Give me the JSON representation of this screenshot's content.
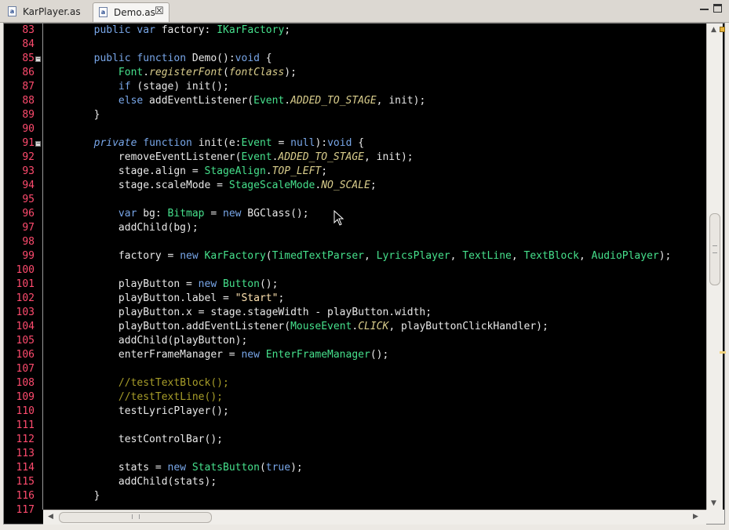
{
  "tabs": [
    {
      "label": "KarPlayer.as",
      "icon": "actionscript-file-icon",
      "active": false
    },
    {
      "label": "Demo.as",
      "icon": "actionscript-file-icon",
      "active": true
    }
  ],
  "close_glyph": "☒",
  "editor": {
    "lines": [
      {
        "n": "83",
        "fold": false,
        "tokens": [
          [
            "def",
            "        "
          ],
          [
            "kw",
            "public"
          ],
          [
            "def",
            " "
          ],
          [
            "kw",
            "var"
          ],
          [
            "def",
            " factory: "
          ],
          [
            "type",
            "IKarFactory"
          ],
          [
            "def",
            ";"
          ]
        ]
      },
      {
        "n": "84",
        "fold": false,
        "tokens": []
      },
      {
        "n": "85",
        "fold": true,
        "tokens": [
          [
            "def",
            "        "
          ],
          [
            "kw",
            "public"
          ],
          [
            "def",
            " "
          ],
          [
            "kw",
            "function"
          ],
          [
            "def",
            " Demo():"
          ],
          [
            "kw",
            "void"
          ],
          [
            "def",
            " {"
          ]
        ]
      },
      {
        "n": "86",
        "fold": false,
        "tokens": [
          [
            "def",
            "            "
          ],
          [
            "type",
            "Font"
          ],
          [
            "def",
            "."
          ],
          [
            "ital",
            "registerFont"
          ],
          [
            "def",
            "("
          ],
          [
            "ital",
            "fontClass"
          ],
          [
            "def",
            ");"
          ]
        ]
      },
      {
        "n": "87",
        "fold": false,
        "tokens": [
          [
            "def",
            "            "
          ],
          [
            "kw",
            "if"
          ],
          [
            "def",
            " (stage) init();"
          ]
        ]
      },
      {
        "n": "88",
        "fold": false,
        "tokens": [
          [
            "def",
            "            "
          ],
          [
            "kw",
            "else"
          ],
          [
            "def",
            " addEventListener("
          ],
          [
            "type",
            "Event"
          ],
          [
            "def",
            "."
          ],
          [
            "ital",
            "ADDED_TO_STAGE"
          ],
          [
            "def",
            ", init);"
          ]
        ]
      },
      {
        "n": "89",
        "fold": false,
        "tokens": [
          [
            "def",
            "        }"
          ]
        ]
      },
      {
        "n": "90",
        "fold": false,
        "tokens": []
      },
      {
        "n": "91",
        "fold": true,
        "tokens": [
          [
            "def",
            "        "
          ],
          [
            "kwi",
            "private"
          ],
          [
            "def",
            " "
          ],
          [
            "kw",
            "function"
          ],
          [
            "def",
            " init(e:"
          ],
          [
            "type",
            "Event"
          ],
          [
            "def",
            " = "
          ],
          [
            "kw",
            "null"
          ],
          [
            "def",
            "):"
          ],
          [
            "kw",
            "void"
          ],
          [
            "def",
            " {"
          ]
        ]
      },
      {
        "n": "92",
        "fold": false,
        "tokens": [
          [
            "def",
            "            removeEventListener("
          ],
          [
            "type",
            "Event"
          ],
          [
            "def",
            "."
          ],
          [
            "ital",
            "ADDED_TO_STAGE"
          ],
          [
            "def",
            ", init);"
          ]
        ]
      },
      {
        "n": "93",
        "fold": false,
        "tokens": [
          [
            "def",
            "            stage.align = "
          ],
          [
            "type",
            "StageAlign"
          ],
          [
            "def",
            "."
          ],
          [
            "ital",
            "TOP_LEFT"
          ],
          [
            "def",
            ";"
          ]
        ]
      },
      {
        "n": "94",
        "fold": false,
        "tokens": [
          [
            "def",
            "            stage.scaleMode = "
          ],
          [
            "type",
            "StageScaleMode"
          ],
          [
            "def",
            "."
          ],
          [
            "ital",
            "NO_SCALE"
          ],
          [
            "def",
            ";"
          ]
        ]
      },
      {
        "n": "95",
        "fold": false,
        "tokens": []
      },
      {
        "n": "96",
        "fold": false,
        "tokens": [
          [
            "def",
            "            "
          ],
          [
            "kw",
            "var"
          ],
          [
            "def",
            " bg: "
          ],
          [
            "type",
            "Bitmap"
          ],
          [
            "def",
            " = "
          ],
          [
            "kw",
            "new"
          ],
          [
            "def",
            " BGClass();"
          ]
        ]
      },
      {
        "n": "97",
        "fold": false,
        "tokens": [
          [
            "def",
            "            addChild(bg);"
          ]
        ]
      },
      {
        "n": "98",
        "fold": false,
        "tokens": []
      },
      {
        "n": "99",
        "fold": false,
        "tokens": [
          [
            "def",
            "            factory = "
          ],
          [
            "kw",
            "new"
          ],
          [
            "def",
            " "
          ],
          [
            "type",
            "KarFactory"
          ],
          [
            "def",
            "("
          ],
          [
            "type",
            "TimedTextParser"
          ],
          [
            "def",
            ", "
          ],
          [
            "type",
            "LyricsPlayer"
          ],
          [
            "def",
            ", "
          ],
          [
            "type",
            "TextLine"
          ],
          [
            "def",
            ", "
          ],
          [
            "type",
            "TextBlock"
          ],
          [
            "def",
            ", "
          ],
          [
            "type",
            "AudioPlayer"
          ],
          [
            "def",
            ");"
          ]
        ]
      },
      {
        "n": "100",
        "fold": false,
        "tokens": []
      },
      {
        "n": "101",
        "fold": false,
        "tokens": [
          [
            "def",
            "            playButton = "
          ],
          [
            "kw",
            "new"
          ],
          [
            "def",
            " "
          ],
          [
            "type",
            "Button"
          ],
          [
            "def",
            "();"
          ]
        ]
      },
      {
        "n": "102",
        "fold": false,
        "tokens": [
          [
            "def",
            "            playButton.label = "
          ],
          [
            "str",
            "\"Start\""
          ],
          [
            "def",
            ";"
          ]
        ]
      },
      {
        "n": "103",
        "fold": false,
        "tokens": [
          [
            "def",
            "            playButton.x = stage.stageWidth - playButton.width;"
          ]
        ]
      },
      {
        "n": "104",
        "fold": false,
        "tokens": [
          [
            "def",
            "            playButton.addEventListener("
          ],
          [
            "type",
            "MouseEvent"
          ],
          [
            "def",
            "."
          ],
          [
            "ital",
            "CLICK"
          ],
          [
            "def",
            ", playButtonClickHandler);"
          ]
        ]
      },
      {
        "n": "105",
        "fold": false,
        "tokens": [
          [
            "def",
            "            addChild(playButton);"
          ]
        ]
      },
      {
        "n": "106",
        "fold": false,
        "tokens": [
          [
            "def",
            "            enterFrameManager = "
          ],
          [
            "kw",
            "new"
          ],
          [
            "def",
            " "
          ],
          [
            "type",
            "EnterFrameManager"
          ],
          [
            "def",
            "();"
          ]
        ]
      },
      {
        "n": "107",
        "fold": false,
        "tokens": []
      },
      {
        "n": "108",
        "fold": false,
        "tokens": [
          [
            "def",
            "            "
          ],
          [
            "cmt",
            "//testTextBlock();"
          ]
        ]
      },
      {
        "n": "109",
        "fold": false,
        "tokens": [
          [
            "def",
            "            "
          ],
          [
            "cmt",
            "//testTextLine();"
          ]
        ]
      },
      {
        "n": "110",
        "fold": false,
        "tokens": [
          [
            "def",
            "            testLyricPlayer();"
          ]
        ]
      },
      {
        "n": "111",
        "fold": false,
        "tokens": []
      },
      {
        "n": "112",
        "fold": false,
        "tokens": [
          [
            "def",
            "            testControlBar();"
          ]
        ]
      },
      {
        "n": "113",
        "fold": false,
        "tokens": []
      },
      {
        "n": "114",
        "fold": false,
        "tokens": [
          [
            "def",
            "            stats = "
          ],
          [
            "kw",
            "new"
          ],
          [
            "def",
            " "
          ],
          [
            "type",
            "StatsButton"
          ],
          [
            "def",
            "("
          ],
          [
            "kw",
            "true"
          ],
          [
            "def",
            ");"
          ]
        ]
      },
      {
        "n": "115",
        "fold": false,
        "tokens": [
          [
            "def",
            "            addChild(stats);"
          ]
        ]
      },
      {
        "n": "116",
        "fold": false,
        "tokens": [
          [
            "def",
            "        }"
          ]
        ]
      },
      {
        "n": "117",
        "fold": false,
        "tokens": []
      }
    ]
  },
  "colors": {
    "editor_background": "#000000",
    "line_number": "#ff4b6e",
    "keyword": "#78a6e8",
    "type": "#46e08c",
    "constant_italic": "#d9cd8c",
    "comment": "#a79d29",
    "string": "#ffe3b0"
  }
}
